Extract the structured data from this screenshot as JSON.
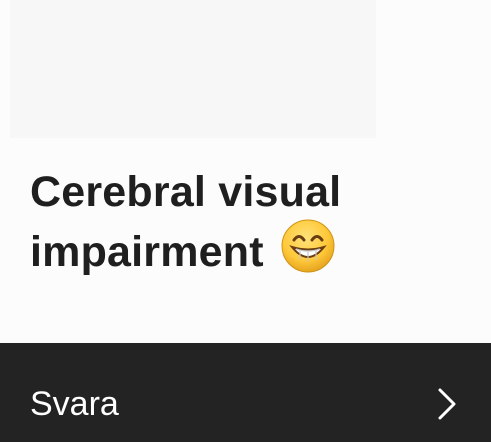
{
  "card": {
    "title": "Cerebral visual impairment",
    "title_emoji_icon": "grinning-face-emoji"
  },
  "action": {
    "label": "Svara",
    "icon": "chevron-right-icon"
  },
  "colors": {
    "background": "#fcfcfc",
    "action_bar": "#232323",
    "title_text": "#1f1f1f",
    "action_text": "#ffffff"
  }
}
